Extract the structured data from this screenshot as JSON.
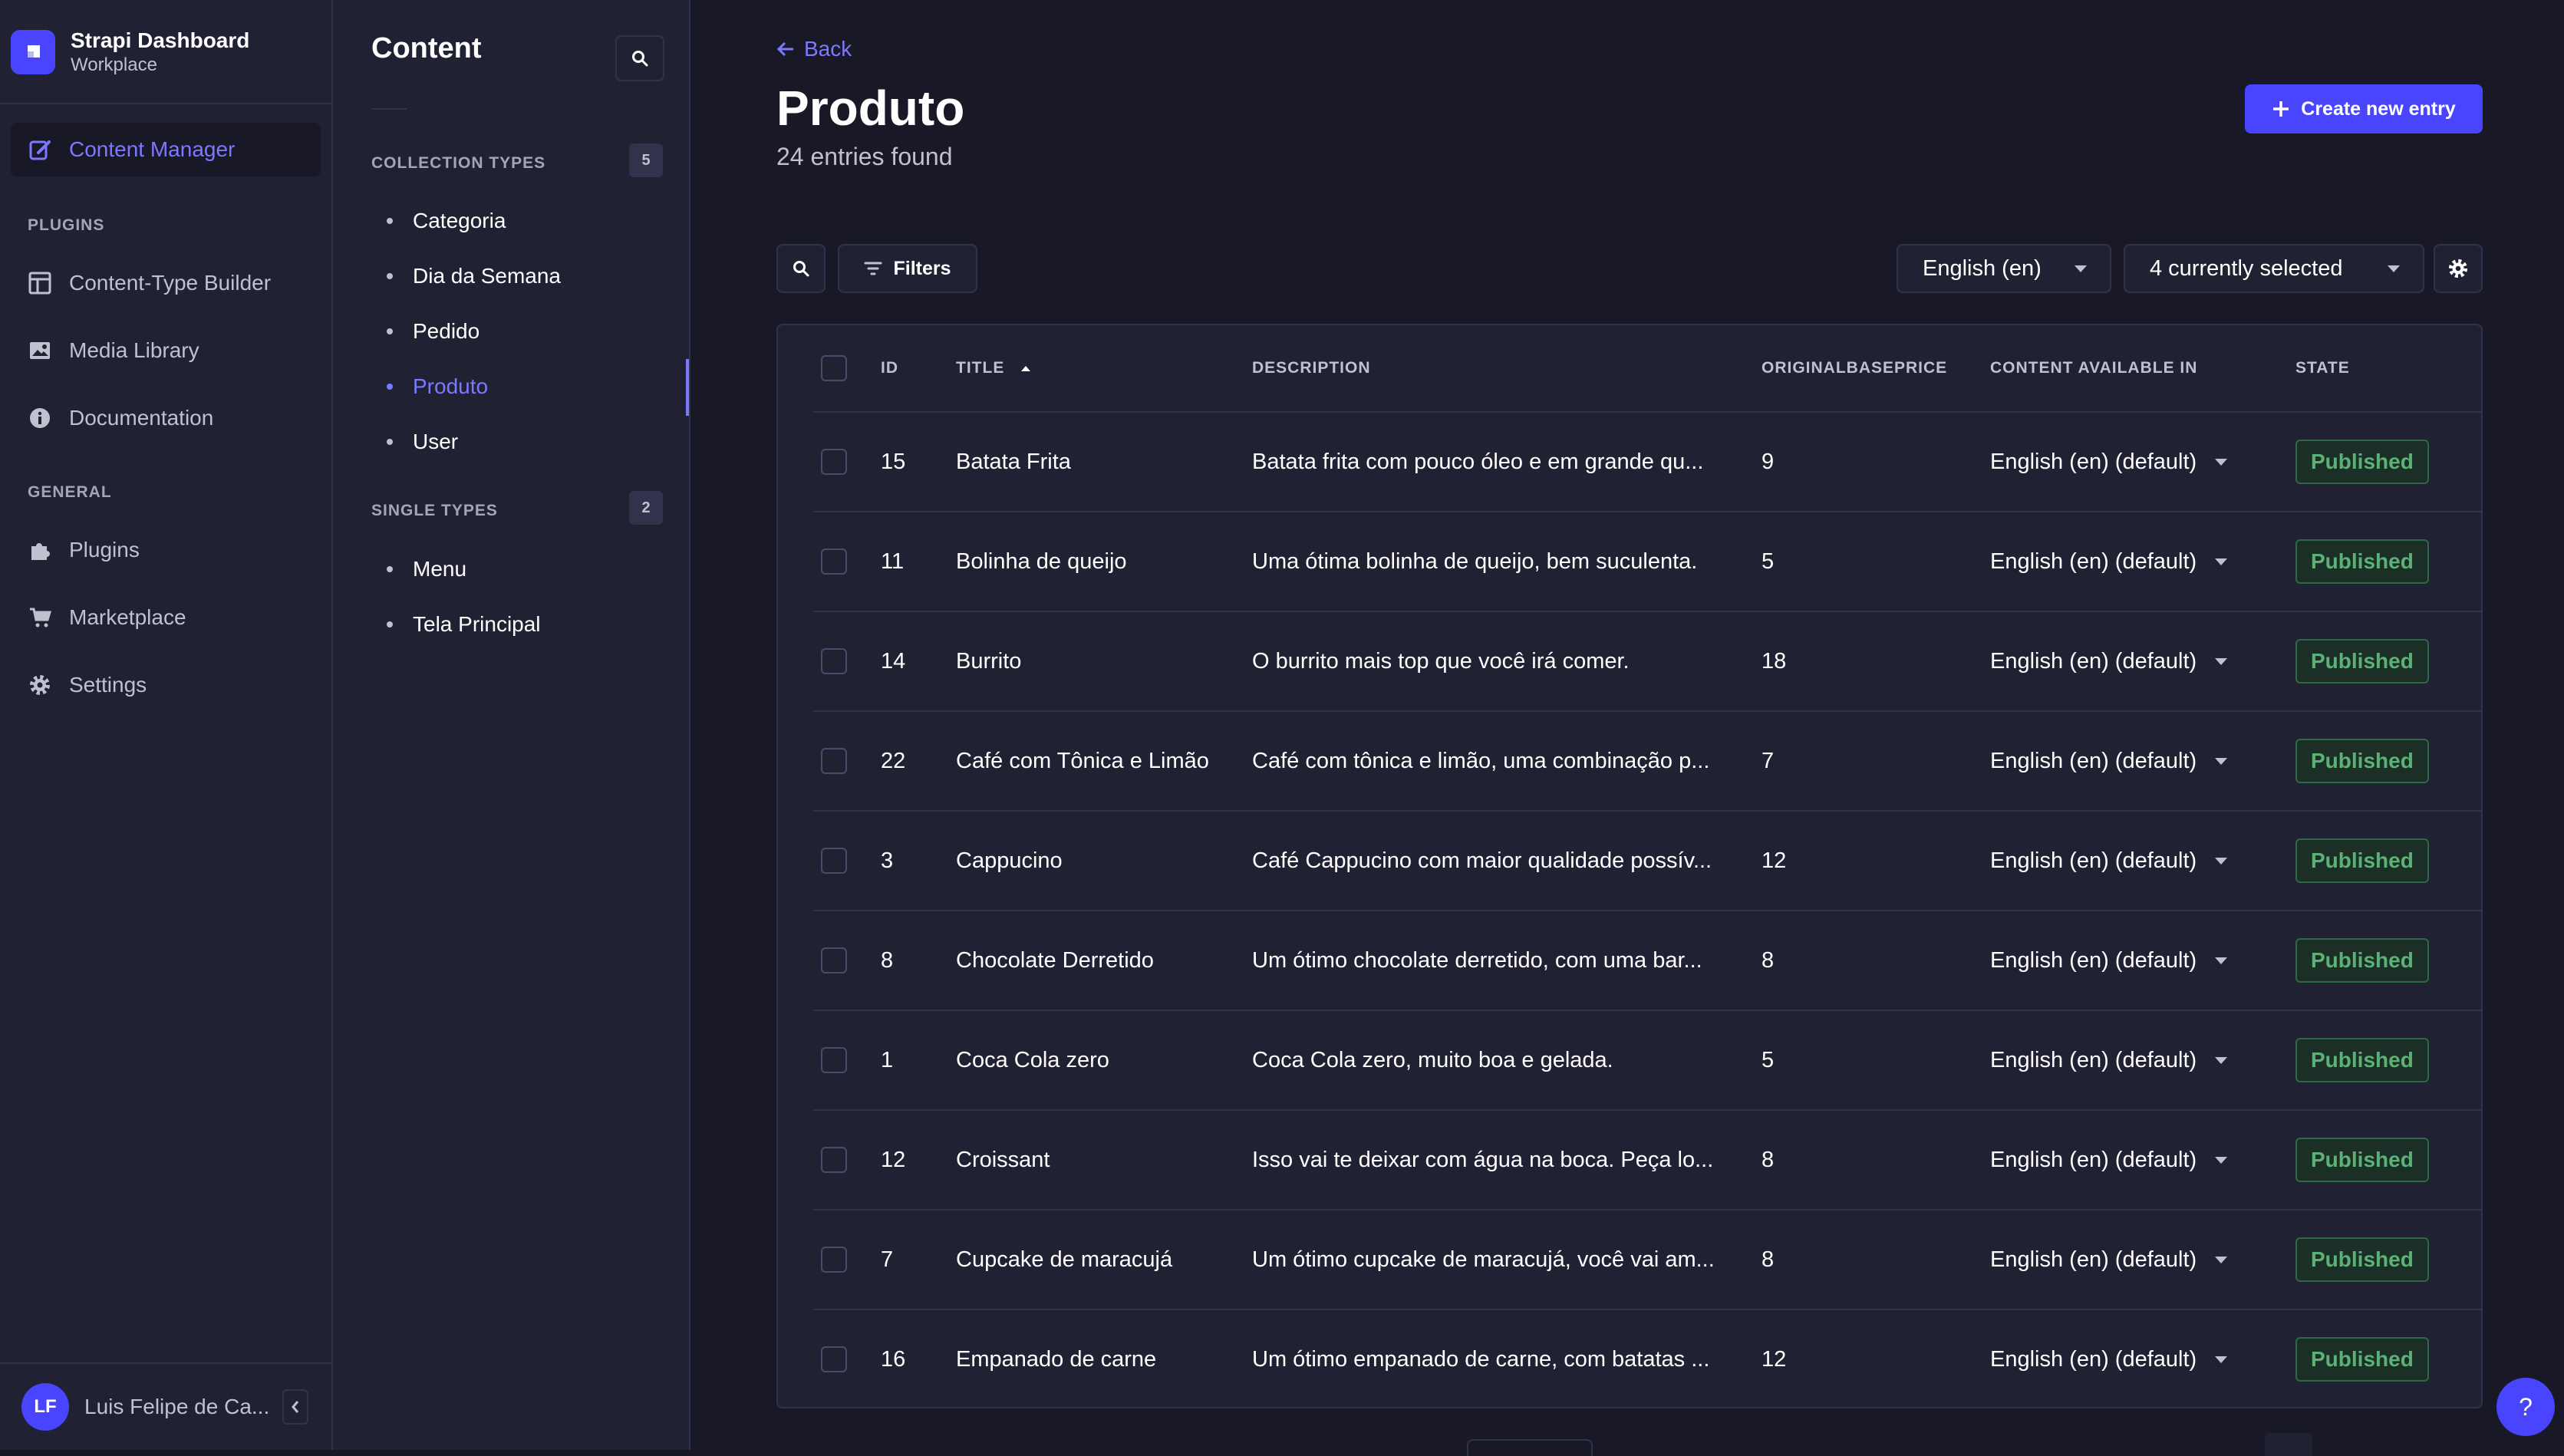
{
  "app": {
    "title": "Strapi Dashboard",
    "workspace": "Workplace"
  },
  "nav": {
    "active": {
      "label": "Content Manager",
      "icon": "pen-icon"
    },
    "plugins_heading": "PLUGINS",
    "plugins": [
      {
        "label": "Content-Type Builder",
        "icon": "layout-icon"
      },
      {
        "label": "Media Library",
        "icon": "image-icon"
      },
      {
        "label": "Documentation",
        "icon": "info-icon"
      }
    ],
    "general_heading": "GENERAL",
    "general": [
      {
        "label": "Plugins",
        "icon": "puzzle-icon"
      },
      {
        "label": "Marketplace",
        "icon": "cart-icon"
      },
      {
        "label": "Settings",
        "icon": "gear-icon"
      }
    ],
    "user": {
      "initials": "LF",
      "name": "Luis Felipe de Ca..."
    }
  },
  "subnav": {
    "title": "Content",
    "collection_heading": "COLLECTION TYPES",
    "collection_count": "5",
    "collection_items": [
      "Categoria",
      "Dia da Semana",
      "Pedido",
      "Produto",
      "User"
    ],
    "active_item": "Produto",
    "single_heading": "SINGLE TYPES",
    "single_count": "2",
    "single_items": [
      "Menu",
      "Tela Principal"
    ]
  },
  "main": {
    "back_label": "Back",
    "title": "Produto",
    "subtitle": "24 entries found",
    "create_label": "Create new entry",
    "filters_label": "Filters",
    "locale_select": "English (en)",
    "columns_select": "4 currently selected"
  },
  "table": {
    "headers": {
      "id": "ID",
      "title": "TITLE",
      "description": "DESCRIPTION",
      "price": "ORIGINALBASEPRICE",
      "locale": "CONTENT AVAILABLE IN",
      "state": "STATE"
    },
    "rows": [
      {
        "id": "15",
        "title": "Batata Frita",
        "description": "Batata frita com pouco óleo e em grande qu...",
        "price": "9",
        "locale": "English (en) (default)",
        "state": "Published"
      },
      {
        "id": "11",
        "title": "Bolinha de queijo",
        "description": "Uma ótima bolinha de queijo, bem suculenta.",
        "price": "5",
        "locale": "English (en) (default)",
        "state": "Published"
      },
      {
        "id": "14",
        "title": "Burrito",
        "description": "O burrito mais top que você irá comer.",
        "price": "18",
        "locale": "English (en) (default)",
        "state": "Published"
      },
      {
        "id": "22",
        "title": "Café com Tônica e Limão",
        "description": "Café com tônica e limão, uma combinação p...",
        "price": "7",
        "locale": "English (en) (default)",
        "state": "Published"
      },
      {
        "id": "3",
        "title": "Cappucino",
        "description": "Café Cappucino com maior qualidade possív...",
        "price": "12",
        "locale": "English (en) (default)",
        "state": "Published"
      },
      {
        "id": "8",
        "title": "Chocolate Derretido",
        "description": "Um ótimo chocolate derretido, com uma bar...",
        "price": "8",
        "locale": "English (en) (default)",
        "state": "Published"
      },
      {
        "id": "1",
        "title": "Coca Cola zero",
        "description": "Coca Cola zero, muito boa e gelada.",
        "price": "5",
        "locale": "English (en) (default)",
        "state": "Published"
      },
      {
        "id": "12",
        "title": "Croissant",
        "description": "Isso vai te deixar com água na boca. Peça lo...",
        "price": "8",
        "locale": "English (en) (default)",
        "state": "Published"
      },
      {
        "id": "7",
        "title": "Cupcake de maracujá",
        "description": "Um ótimo cupcake de maracujá, você vai am...",
        "price": "8",
        "locale": "English (en) (default)",
        "state": "Published"
      },
      {
        "id": "16",
        "title": "Empanado de carne",
        "description": "Um ótimo empanado de carne, com batatas ...",
        "price": "12",
        "locale": "English (en) (default)",
        "state": "Published"
      }
    ]
  },
  "help_label": "?"
}
